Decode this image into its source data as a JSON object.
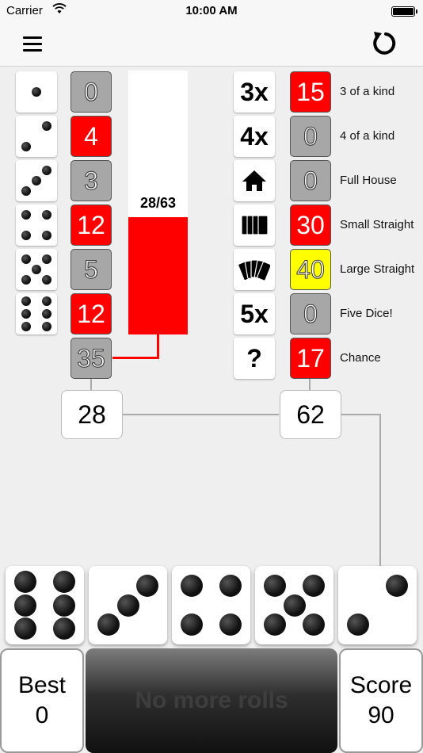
{
  "status": {
    "carrier": "Carrier",
    "time": "10:00 AM"
  },
  "upper": {
    "rows": [
      {
        "pips": 1,
        "score": "0",
        "style": "gray"
      },
      {
        "pips": 2,
        "score": "4",
        "style": "red"
      },
      {
        "pips": 3,
        "score": "3",
        "style": "gray"
      },
      {
        "pips": 4,
        "score": "12",
        "style": "red"
      },
      {
        "pips": 5,
        "score": "5",
        "style": "gray"
      },
      {
        "pips": 6,
        "score": "12",
        "style": "red"
      }
    ],
    "bonus": {
      "score": "35",
      "style": "gray"
    },
    "progress": {
      "label": "28/63",
      "fraction": 0.444
    },
    "total": "28"
  },
  "lower": {
    "rows": [
      {
        "icon": "3x",
        "icon_name": "three-of-a-kind-icon",
        "score": "15",
        "style": "red",
        "label": "3 of a kind"
      },
      {
        "icon": "4x",
        "icon_name": "four-of-a-kind-icon",
        "score": "0",
        "style": "gray",
        "label": "4 of a kind"
      },
      {
        "icon": "",
        "icon_name": "house-icon",
        "score": "0",
        "style": "gray",
        "label": "Full House"
      },
      {
        "icon": "",
        "icon_name": "cards-small-icon",
        "score": "30",
        "style": "red",
        "label": "Small Straight"
      },
      {
        "icon": "",
        "icon_name": "cards-large-icon",
        "score": "40",
        "style": "yellow",
        "label": "Large Straight"
      },
      {
        "icon": "5x",
        "icon_name": "five-of-a-kind-icon",
        "score": "0",
        "style": "gray",
        "label": "Five Dice!"
      },
      {
        "icon": "?",
        "icon_name": "chance-icon",
        "score": "17",
        "style": "red",
        "label": "Chance"
      }
    ],
    "total": "62"
  },
  "dice": [
    6,
    3,
    4,
    5,
    2
  ],
  "best": {
    "title": "Best",
    "value": "0"
  },
  "roll_button": "No more rolls",
  "score": {
    "title": "Score",
    "value": "90"
  },
  "colors": {
    "red": "#ff0000",
    "yellow": "#ffff00",
    "gray": "#a7a7a7"
  }
}
